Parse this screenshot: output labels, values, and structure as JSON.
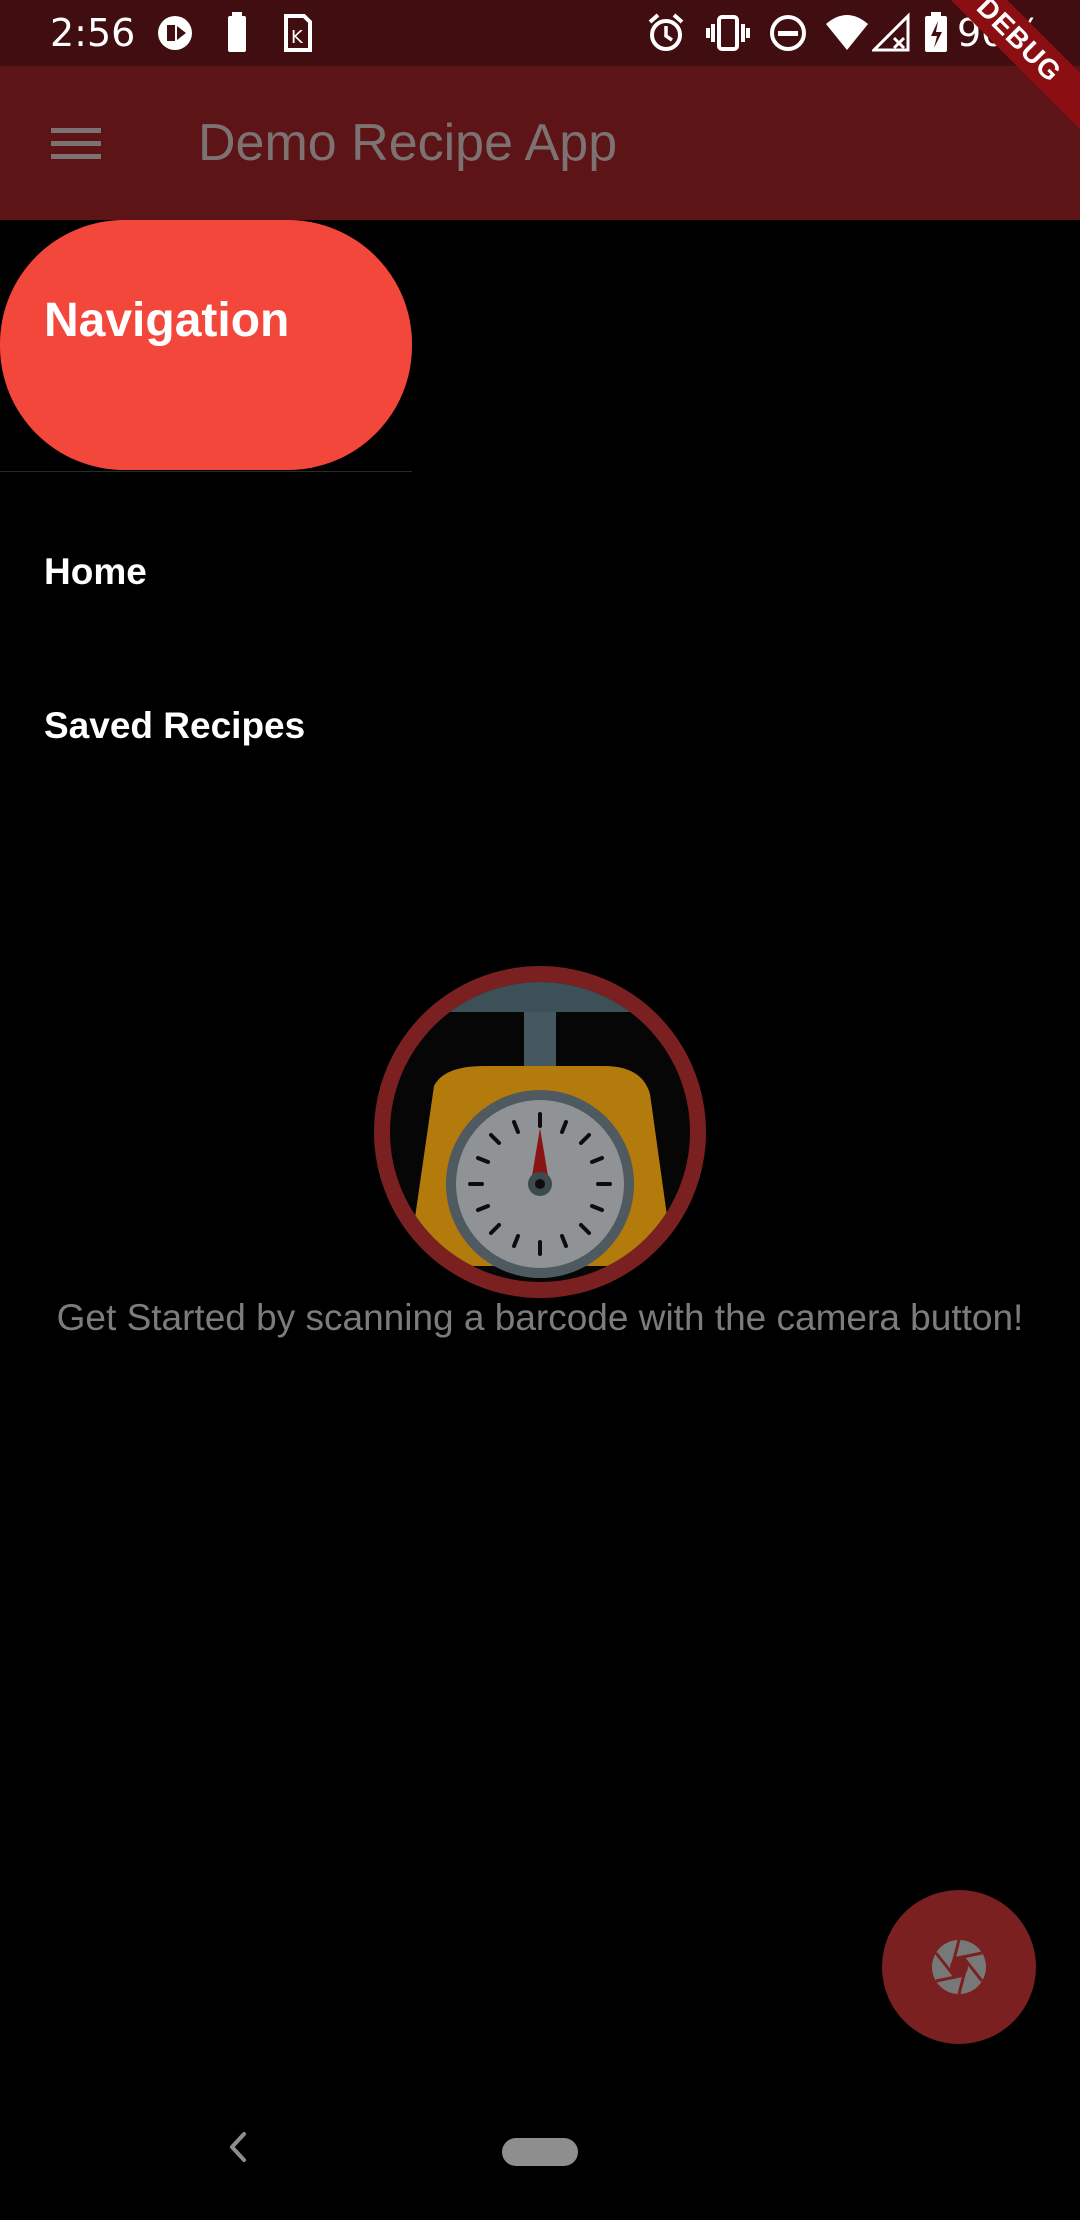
{
  "status_bar": {
    "time": "2:56",
    "battery_percent": "90%",
    "icons": [
      "media-control-icon",
      "battery-saver-icon",
      "sim-icon",
      "alarm-icon",
      "vibrate-icon",
      "do-not-disturb-icon",
      "wifi-icon",
      "cellular-no-data-icon",
      "battery-charging-icon"
    ]
  },
  "debug_banner": "DEBUG",
  "app_bar": {
    "title": "Demo Recipe App",
    "menu_icon": "hamburger-menu-icon",
    "color": "#5c1417"
  },
  "drawer": {
    "header_title": "Navigation",
    "header_color": "#f4473b",
    "items": [
      {
        "label": "Home"
      },
      {
        "label": "Saved Recipes"
      }
    ]
  },
  "main": {
    "logo_icon": "kitchen-scale-icon",
    "empty_message": "Get Started by scanning a barcode with the camera button!"
  },
  "fab": {
    "icon": "camera-shutter-icon",
    "color": "#7b2020"
  },
  "nav_bar": {
    "back_icon": "back-chevron-icon",
    "home_icon": "home-pill-icon"
  }
}
